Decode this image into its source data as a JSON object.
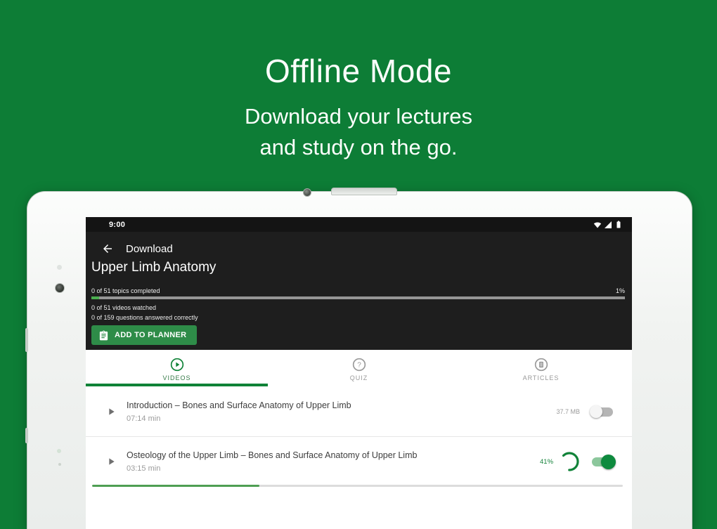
{
  "hero": {
    "title": "Offline Mode",
    "subtitle_line1": "Download your lectures",
    "subtitle_line2": "and study on the go."
  },
  "statusbar": {
    "time": "9:00",
    "icons": [
      "wifi-icon",
      "cellular-signal-icon",
      "battery-icon"
    ]
  },
  "header": {
    "nav_title": "Download",
    "course_title": "Upper Limb Anatomy",
    "topics_label": "0 of 51 topics completed",
    "topics_percent": "1%",
    "topics_fill_pct": 1.5,
    "videos_watched": "0 of 51 videos watched",
    "questions_answered": "0 of 159 questions answered correctly",
    "add_to_planner_label": "ADD TO PLANNER"
  },
  "tabs": [
    {
      "label": "VIDEOS",
      "icon": "play-circle-icon",
      "active": true
    },
    {
      "label": "QUIZ",
      "icon": "question-circle-icon",
      "active": false
    },
    {
      "label": "ARTICLES",
      "icon": "article-circle-icon",
      "active": false
    }
  ],
  "videos": [
    {
      "title": "Introduction – Bones and Surface Anatomy of Upper Limb",
      "duration": "07:14 min",
      "file_size": "37.7 MB",
      "download_toggle": "off"
    },
    {
      "title": "Osteology of the Upper Limb – Bones and Surface Anatomy of Upper Limb",
      "duration": "03:15 min",
      "download_percent": "41%",
      "download_toggle": "on",
      "download_fill_pct": 31.5
    }
  ],
  "colors": {
    "background_green": "#0d7d36",
    "accent_green": "#0f8237",
    "button_green": "#2e8c48",
    "header_dark": "#1e1e1e",
    "inactive_gray": "#9a9a9a"
  }
}
